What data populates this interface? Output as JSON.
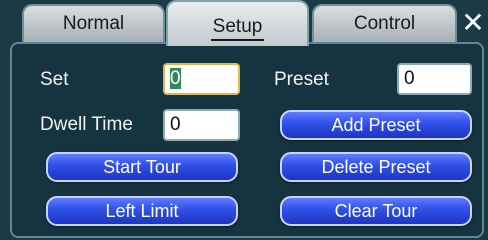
{
  "tabs": [
    {
      "label": "Normal"
    },
    {
      "label": "Setup"
    },
    {
      "label": "Control"
    }
  ],
  "close_label": "✕",
  "form": {
    "set_label": "Set",
    "set_value": "0",
    "preset_label": "Preset",
    "preset_value": "0",
    "dwell_label": "Dwell Time",
    "dwell_value": "0"
  },
  "buttons": {
    "add_preset": "Add Preset",
    "start_tour": "Start Tour",
    "delete_preset": "Delete Preset",
    "left_limit": "Left Limit",
    "clear_tour": "Clear Tour"
  },
  "colors": {
    "background": "#1b3a45",
    "button": "#2f4fe6",
    "focus": "#e2b44a"
  }
}
